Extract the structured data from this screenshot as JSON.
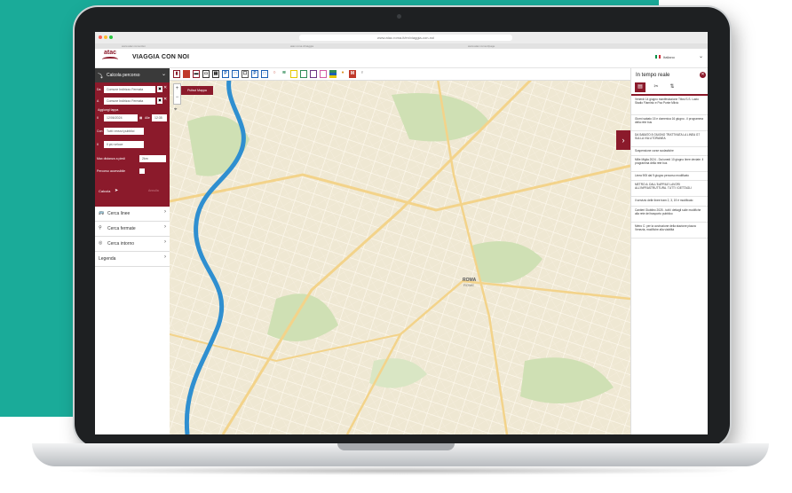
{
  "browser": {
    "url": "www.atac.roma.it/en/viaggia-con-noi",
    "tabs": [
      "www.atac.roma.it/en",
      "atac.roma.it/viaggia",
      "www.atac.roma.it/page"
    ]
  },
  "header": {
    "logo": "atac",
    "title": "VIAGGIA CON NOI",
    "language": "Italiano"
  },
  "left_panel": {
    "heading": "Calcola percorso",
    "from_label": "Da",
    "from_placeholder": "Comune Indirizzo Fermata",
    "to_label": "A",
    "to_placeholder": "Comune Indirizzo Fermata",
    "add_stop": "Aggiungi tappa",
    "date_label": "Il",
    "date_value": "12/06/2024",
    "time_label": "Alle",
    "time_value": "12:35",
    "with_label": "Con",
    "with_value": "Tutti i mezzi pubblici",
    "mode_label": "Il",
    "mode_value": "Il più veloce",
    "walk_label": "Max distanza a piedi",
    "walk_value": "2km",
    "accessible_label": "Percorso accessibile",
    "calc_button": "Calcola",
    "reset_button": "Annulla",
    "menu": [
      {
        "label": "Cerca linee",
        "icon": "bus-icon"
      },
      {
        "label": "Cerca fermate",
        "icon": "pin-icon"
      },
      {
        "label": "Cerca intorno",
        "icon": "target-icon"
      },
      {
        "label": "Legenda",
        "icon": ""
      }
    ]
  },
  "map": {
    "clear_button": "Pulisci Mappa",
    "city_label": "ROMA",
    "city_sub": "ROME",
    "zoom_in": "+",
    "zoom_out": "−"
  },
  "right_panel": {
    "title": "In tempo reale",
    "news": [
      "Venerdì 14 giugno manifestazione Tifosi S.S. Lazio Stadio Flaminio e Pza Ponte Milvio",
      "Giorni sabato 15 e domenica 16 giugno - il programma della rete bus",
      "DA SABATO 8 GIUGNO TRATTIVATA LA LINEA G7 SULLA VIA LITORANEA",
      "Sospensione corse scolastiche",
      "Mille Miglia 2024 - Da lunedì 10 giugno linee deviate. Il programma della rete bus",
      "Linea 905 dal 9 giugno percorso modificato",
      "METRO A: DALL'8 APRILE LAVORI ALL'INFRASTRUTTURA. TUTTI I DETTAGLI",
      "Il servizio delle linee tram 2, 3, 19 è modificato",
      "Cantieri Giubileo 2025 - tutti i dettagli sulle modifiche alla rete del trasporto pubblico",
      "Metro C: per la costruzione della stazione piazza Venezia, modifiche alla viabilità"
    ]
  },
  "colors": {
    "brand": "#8b1a2b",
    "background": "#1aab99",
    "river": "#2f8fd0",
    "map_base": "#efe8d3"
  }
}
